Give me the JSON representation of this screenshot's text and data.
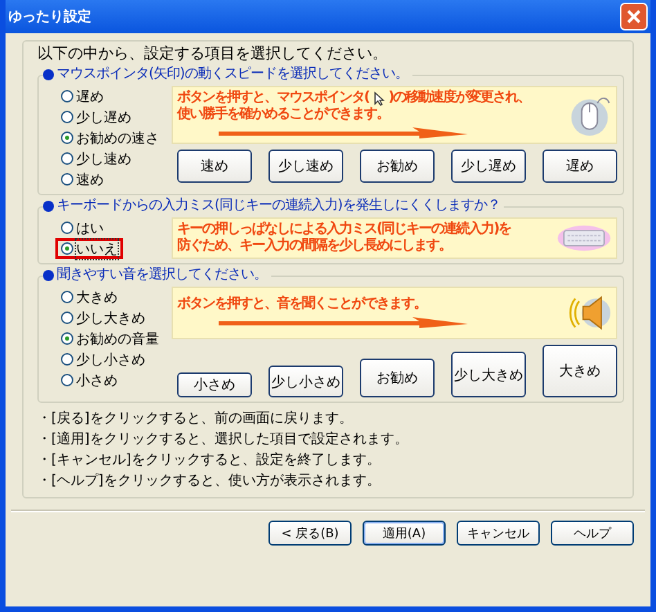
{
  "window": {
    "title": "ゆったり設定"
  },
  "intro": "以下の中から、設定する項目を選択してください。",
  "sections": [
    {
      "kind": "mouse",
      "heading": "マウスポインタ(矢印)の動くスピードを選択してください。",
      "options": [
        {
          "label": "遅め",
          "selected": false,
          "focused": false
        },
        {
          "label": "少し遅め",
          "selected": false,
          "focused": false
        },
        {
          "label": "お勧めの速さ",
          "selected": true,
          "focused": false
        },
        {
          "label": "少し速め",
          "selected": false,
          "focused": false
        },
        {
          "label": "速め",
          "selected": false,
          "focused": false
        }
      ],
      "info": [
        [
          "ボタンを押すと、マウスポインタ(",
          ")の移動速度が変更され、"
        ],
        [
          "使い勝手を確かめることができます。"
        ]
      ],
      "buttons": [
        "速め",
        "少し速め",
        "お勧め",
        "少し遅め",
        "遅め"
      ]
    },
    {
      "kind": "keyboard",
      "heading": "キーボードからの入力ミス(同じキーの連続入力)を発生しにくくしますか？",
      "options": [
        {
          "label": "はい",
          "selected": false,
          "focused": false
        },
        {
          "label": "いいえ",
          "selected": true,
          "focused": true
        }
      ],
      "info": [
        [
          "キーの押しっぱなしによる入力ミス(同じキーの連続入力)を"
        ],
        [
          "防ぐため、キー入力の間隔を少し長めにします。"
        ]
      ]
    },
    {
      "kind": "sound",
      "heading": "聞きやすい音を選択してください。",
      "options": [
        {
          "label": "大きめ",
          "selected": false,
          "focused": false
        },
        {
          "label": "少し大きめ",
          "selected": false,
          "focused": false
        },
        {
          "label": "お勧めの音量",
          "selected": true,
          "focused": false
        },
        {
          "label": "少し小さめ",
          "selected": false,
          "focused": false
        },
        {
          "label": "小さめ",
          "selected": false,
          "focused": false
        }
      ],
      "info": [
        [
          "ボタンを押すと、音を聞くことができます。"
        ]
      ],
      "buttons": [
        "小さめ",
        "少し小さめ",
        "お勧め",
        "少し大きめ",
        "大きめ"
      ]
    }
  ],
  "notes": [
    "・[戻る]をクリックすると、前の画面に戻ります。",
    "・[適用]をクリックすると、選択した項目で設定されます。",
    "・[キャンセル]をクリックすると、設定を終了します。",
    "・[ヘルプ]をクリックすると、使い方が表示されます。"
  ],
  "footer_buttons": [
    "< 戻る(B)",
    "適用(A)",
    "キャンセル",
    "ヘルプ"
  ]
}
